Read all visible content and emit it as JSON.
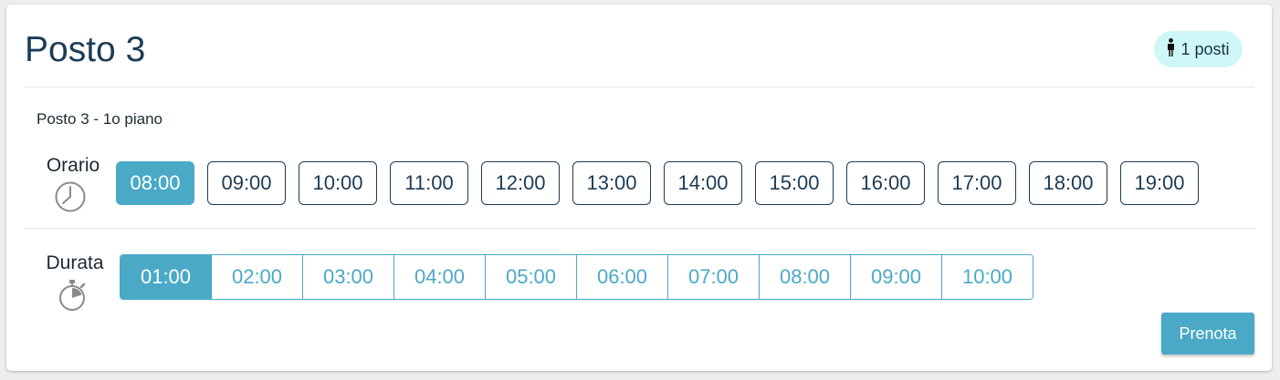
{
  "header": {
    "title": "Posto 3",
    "badge": {
      "icon": "person-icon",
      "label": "1 posti"
    }
  },
  "subtitle": "Posto 3 - 1o piano",
  "orario": {
    "label": "Orario",
    "icon": "clock-icon",
    "selected": "08:00",
    "options": [
      "08:00",
      "09:00",
      "10:00",
      "11:00",
      "12:00",
      "13:00",
      "14:00",
      "15:00",
      "16:00",
      "17:00",
      "18:00",
      "19:00"
    ]
  },
  "durata": {
    "label": "Durata",
    "icon": "stopwatch-icon",
    "selected": "01:00",
    "options": [
      "01:00",
      "02:00",
      "03:00",
      "04:00",
      "05:00",
      "06:00",
      "07:00",
      "08:00",
      "09:00",
      "10:00"
    ]
  },
  "actions": {
    "book_label": "Prenota"
  },
  "colors": {
    "accent": "#4aa9c7",
    "title": "#1d3c55",
    "badge_bg": "#cff7f8",
    "divider": "#e3e6e8"
  }
}
